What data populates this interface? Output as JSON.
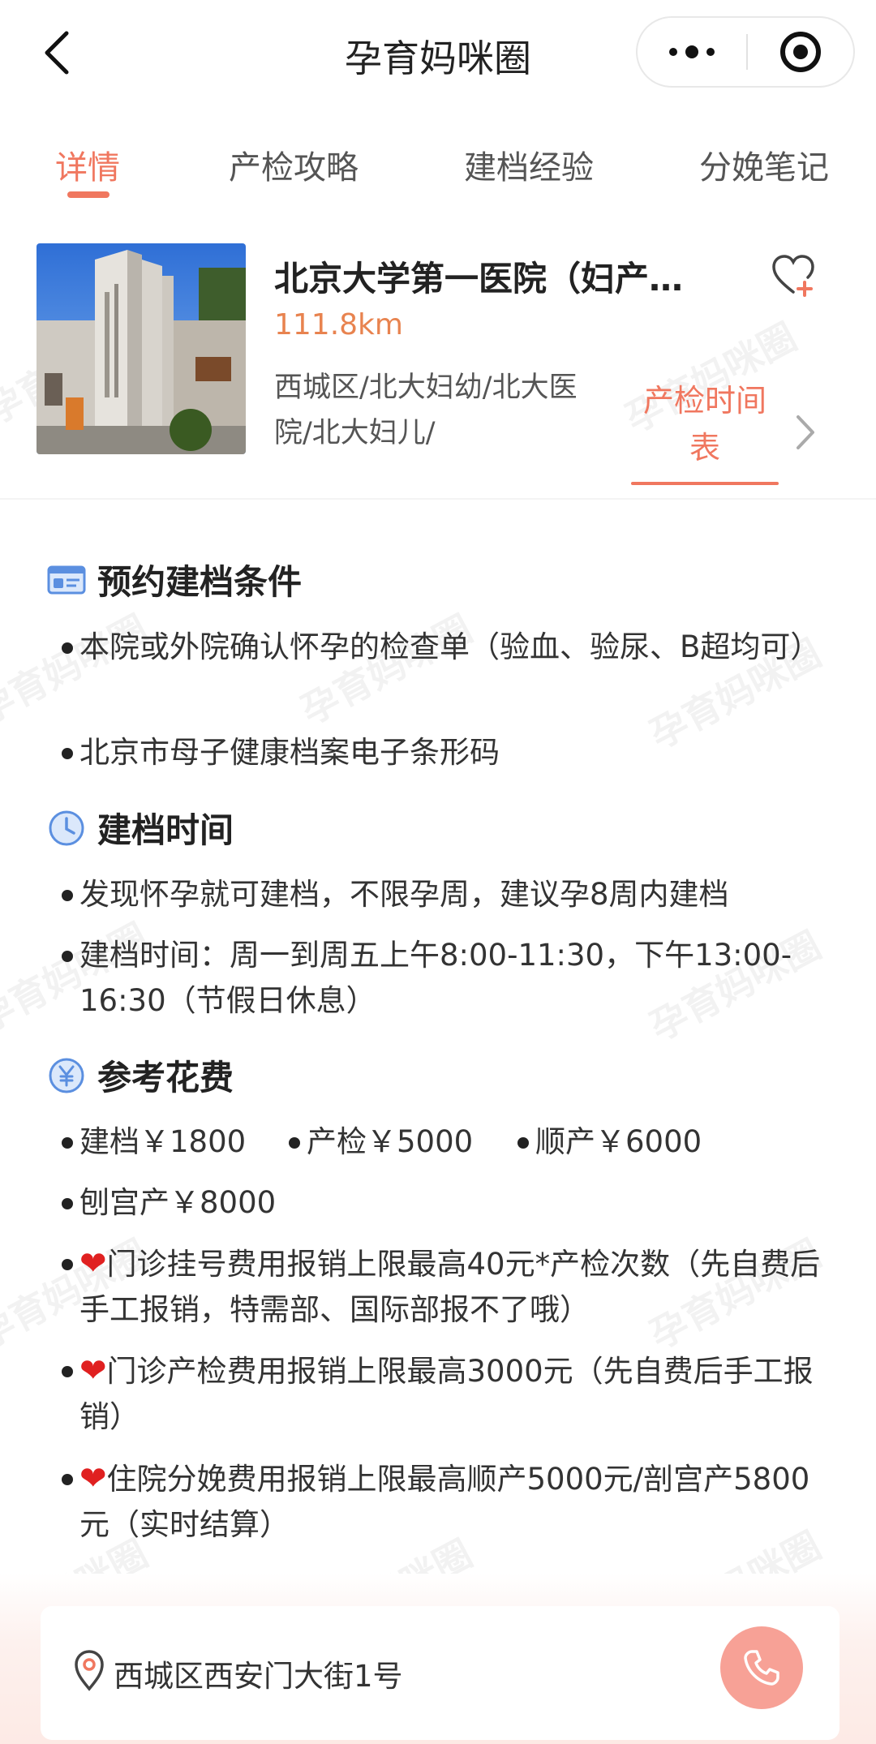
{
  "navbar": {
    "title": "孕育妈咪圈"
  },
  "tabs": [
    "详情",
    "产检攻略",
    "建档经验",
    "分娩笔记"
  ],
  "watermark_text": "孕育妈咪圈",
  "hospital": {
    "name": "北京大学第一医院（妇产…",
    "distance": "111.8km",
    "areas": "西城区/北大妇幼/北大医院/北大妇儿/",
    "schedule_link": "产检时间表"
  },
  "sections": {
    "conditions": {
      "title": "预约建档条件",
      "items": [
        "本院或外院确认怀孕的检查单（验血、验尿、B超均可）",
        "北京市母子健康档案电子条形码"
      ]
    },
    "time": {
      "title": "建档时间",
      "items": [
        "发现怀孕就可建档，不限孕周，建议孕8周内建档",
        "建档时间：周一到周五上午8:00-11:30，下午13:00-16:30（节假日休息）"
      ]
    },
    "fees": {
      "title": "参考花费",
      "inline": [
        "建档￥1800",
        "产检￥5000",
        "顺产￥6000"
      ],
      "csection": "刨宫产￥8000",
      "notes": [
        "门诊挂号费用报销上限最高40元*产检次数（先自费后手工报销，特需部、国际部报不了哦）",
        "门诊产检费用报销上限最高3000元（先自费后手工报销）",
        "住院分娩费用报销上限最高顺产5000元/剖宫产5800元（实时结算）"
      ],
      "heart_glyph": "❤"
    }
  },
  "address": "西城区西安门大街1号",
  "colors": {
    "accent": "#f0775f",
    "distance": "#e8834f",
    "heart": "#e02020",
    "phone_bg": "#f7a196"
  },
  "icons": {
    "back": "chevron-left-icon",
    "more": "more-dots-icon",
    "target": "target-icon",
    "favorite": "heart-plus-icon",
    "schedule_arrow": "chevron-right-icon",
    "conditions": "id-card-icon",
    "time": "clock-icon",
    "fees": "yen-icon",
    "address": "location-pin-icon",
    "phone": "phone-icon"
  }
}
